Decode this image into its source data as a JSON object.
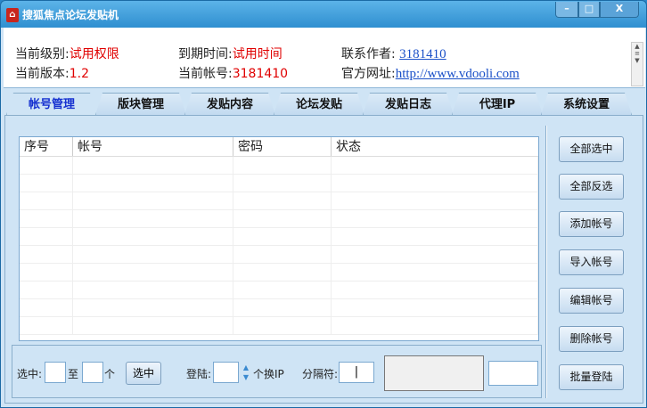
{
  "window": {
    "title": "搜狐焦点论坛发贴机",
    "icon": "house-icon",
    "minimize": "–",
    "maximize": "□",
    "close": "X"
  },
  "info": {
    "level_label": "当前级别:",
    "level_value": "试用权限",
    "expire_label": "到期时间:",
    "expire_value": "试用时间",
    "contact_label": "联系作者:",
    "contact_value": "3181410",
    "version_label": "当前版本:",
    "version_value": "1.2",
    "account_label": "当前帐号:",
    "account_value": "3181410",
    "site_label": "官方网址:",
    "site_value": "http://www.vdooli.com"
  },
  "tabs": [
    "帐号管理",
    "版块管理",
    "发贴内容",
    "论坛发贴",
    "发贴日志",
    "代理IP",
    "系统设置"
  ],
  "list": {
    "columns": [
      "序号",
      "帐号",
      "密码",
      "状态"
    ],
    "rows": []
  },
  "buttons": [
    "全部选中",
    "全部反选",
    "添加帐号",
    "导入帐号",
    "编辑帐号",
    "删除帐号",
    "批量登陆"
  ],
  "bottom": {
    "select_label": "选中:",
    "to_label": "至",
    "unit_label": "个",
    "select_button": "选中",
    "login_label": "登陆:",
    "switch_ip_label": "个换IP",
    "separator_label": "分隔符:",
    "separator_value": "|"
  },
  "colors": {
    "accent": "#2f8fd0",
    "value_red": "#e00000",
    "link": "#1a50c8"
  }
}
